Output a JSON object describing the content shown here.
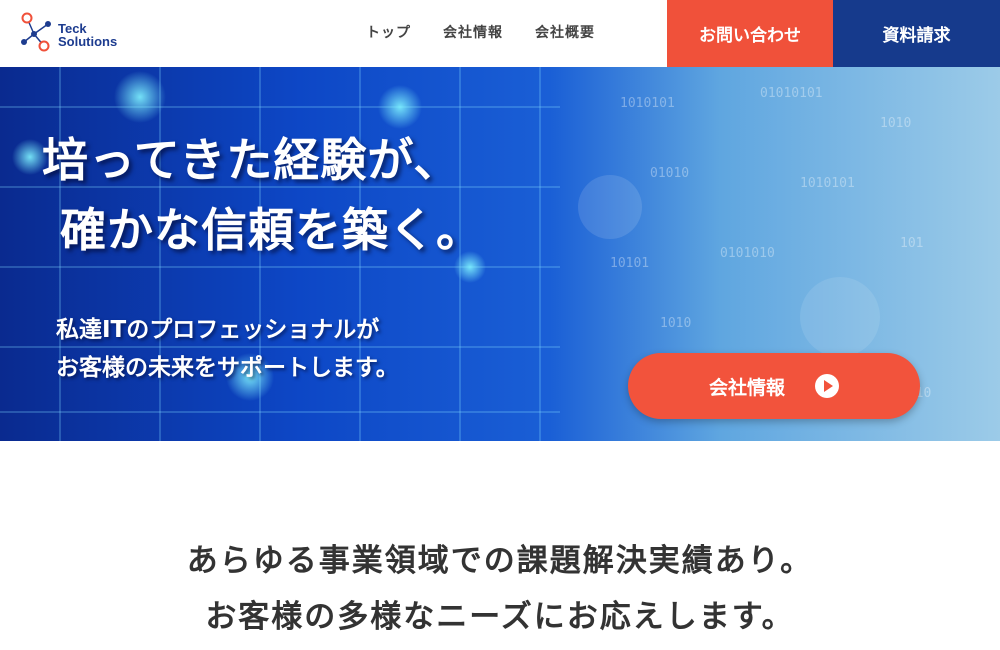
{
  "header": {
    "logo_line1": "Teck",
    "logo_line2": "Solutions",
    "nav": [
      "トップ",
      "会社情報",
      "会社概要"
    ],
    "contact_label": "お問い合わせ",
    "docs_label": "資料請求"
  },
  "hero": {
    "title_line1": "培ってきた経験が、",
    "title_line2": "確かな信頼を築く。",
    "sub_line1": "私達ITのプロフェッショナルが",
    "sub_line2": "お客様の未来をサポートします。",
    "button_label": "会社情報"
  },
  "intro": {
    "line1": "あらゆる事業領域での課題解決実績あり。",
    "line2": "お客様の多様なニーズにお応えします。"
  },
  "colors": {
    "accent": "#f0513a",
    "brand": "#163a8c"
  }
}
